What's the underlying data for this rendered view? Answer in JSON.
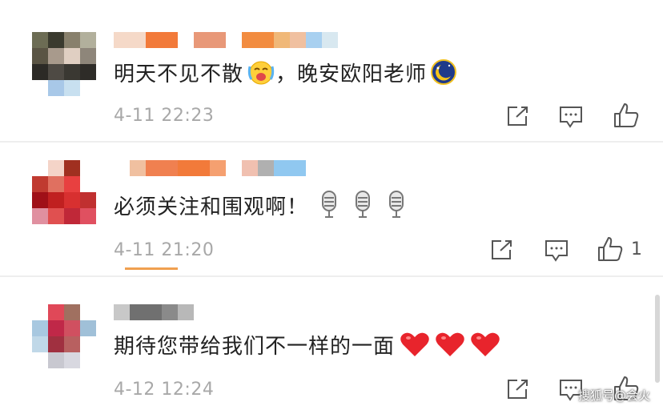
{
  "comments": [
    {
      "text": "明天不见不散",
      "text_after": "，晚安欧阳老师",
      "time": "4-11 22:23",
      "likes": ""
    },
    {
      "text": "必须关注和围观啊！",
      "time": "4-11 21:20",
      "likes": "1"
    },
    {
      "text": "期待您带给我们不一样的一面",
      "time": "4-12 12:24",
      "likes": ""
    }
  ],
  "watermark": "搜狐号@会火"
}
